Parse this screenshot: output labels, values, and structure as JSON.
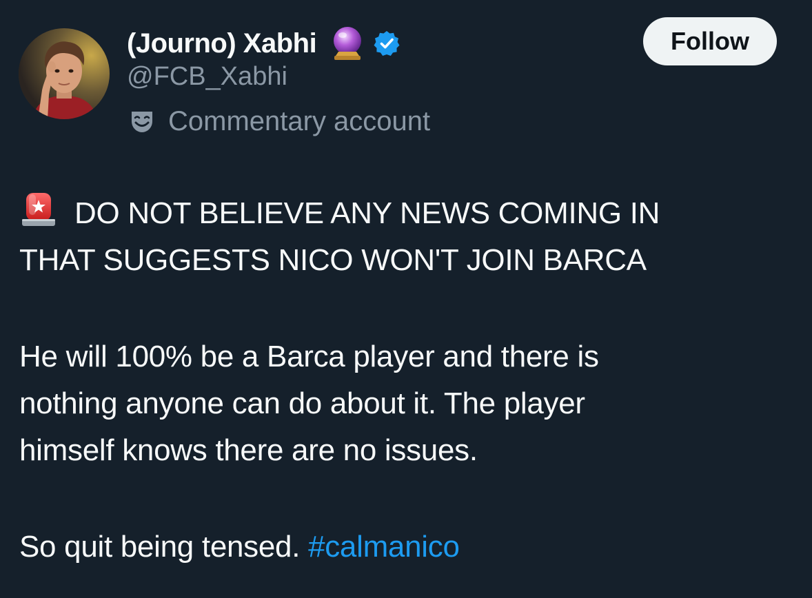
{
  "author": {
    "display_name": "(Journo) Xabhi",
    "handle": "@FCB_Xabhi",
    "label": "Commentary account",
    "verified": true,
    "name_emoji": "crystal-ball-icon"
  },
  "actions": {
    "follow_label": "Follow"
  },
  "tweet": {
    "line1": "DO NOT BELIEVE ANY NEWS COMING IN",
    "line2": "THAT SUGGESTS NICO WON'T JOIN BARCA",
    "para2_line1": "He will 100% be a Barca player and there is",
    "para2_line2": "nothing anyone can do about it. The player",
    "para2_line3": "himself knows there are no issues.",
    "para3_text": "So quit being tensed.",
    "hashtag": "#calmanico",
    "leading_emoji": "siren-icon"
  },
  "colors": {
    "background": "#15202b",
    "text": "#f7f9f9",
    "secondary": "#8b98a5",
    "link": "#1d9bf0",
    "verified": "#1d9bf0"
  }
}
